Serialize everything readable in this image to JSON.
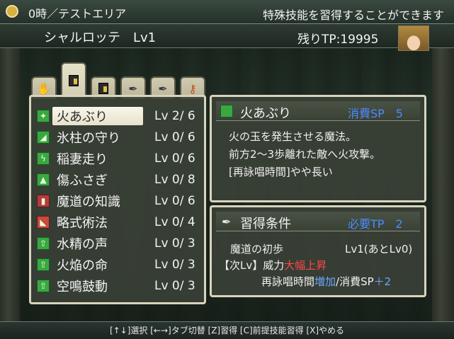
{
  "topbar": {
    "location": "0時／テストエリア",
    "hint": "特殊技能を習得することができます"
  },
  "character": {
    "name": "シャルロッテ　Lv1",
    "remaining_tp": "残りTP:19995"
  },
  "tabs": [
    {
      "icon": "hand-icon"
    },
    {
      "icon": "book-icon"
    },
    {
      "icon": "book-icon"
    },
    {
      "icon": "quill-icon"
    },
    {
      "icon": "quill-icon"
    },
    {
      "icon": "torch-icon"
    }
  ],
  "active_tab": 1,
  "skills": [
    {
      "name": "火あぶり",
      "level": "Lv 2/ 6"
    },
    {
      "name": "氷柱の守り",
      "level": "Lv 0/ 6"
    },
    {
      "name": "稲妻走り",
      "level": "Lv 0/ 6"
    },
    {
      "name": "傷ふさぎ",
      "level": "Lv 0/ 8"
    },
    {
      "name": "魔道の知識",
      "level": "Lv 0/ 6"
    },
    {
      "name": "略式術法",
      "level": "Lv 0/ 4"
    },
    {
      "name": "水精の声",
      "level": "Lv 0/ 3"
    },
    {
      "name": "火焔の命",
      "level": "Lv 0/ 3"
    },
    {
      "name": "空鳴鼓動",
      "level": "Lv 0/ 3"
    }
  ],
  "selected_skill": 0,
  "detail": {
    "name": "火あぶり",
    "cost": "消費SP　5",
    "desc1": "火の玉を発生させる魔法。",
    "desc2": "前方2～3歩離れた敵へ火攻撃。",
    "desc3": "[再詠唱時間]やや長い"
  },
  "requirement": {
    "title": "習得条件",
    "tp": "必要TP　2",
    "req_name": "魔道の初歩",
    "req_level": "Lv1(あとLv0)",
    "next_prefix": "【次Lv】威力",
    "next_power": "大幅上昇",
    "recast_label": "再詠唱時間",
    "recast_value": "増加",
    "sp_label": "/消費SP",
    "sp_value": "＋2"
  },
  "help": "[↑↓]選択 [←→]タブ切替 [Z]習得 [C]前提技能習得 [X]やめる",
  "colors": {
    "cost_blue": "#4a8cff",
    "increase_red": "#ff4848",
    "skill_green": "#3aa840"
  }
}
